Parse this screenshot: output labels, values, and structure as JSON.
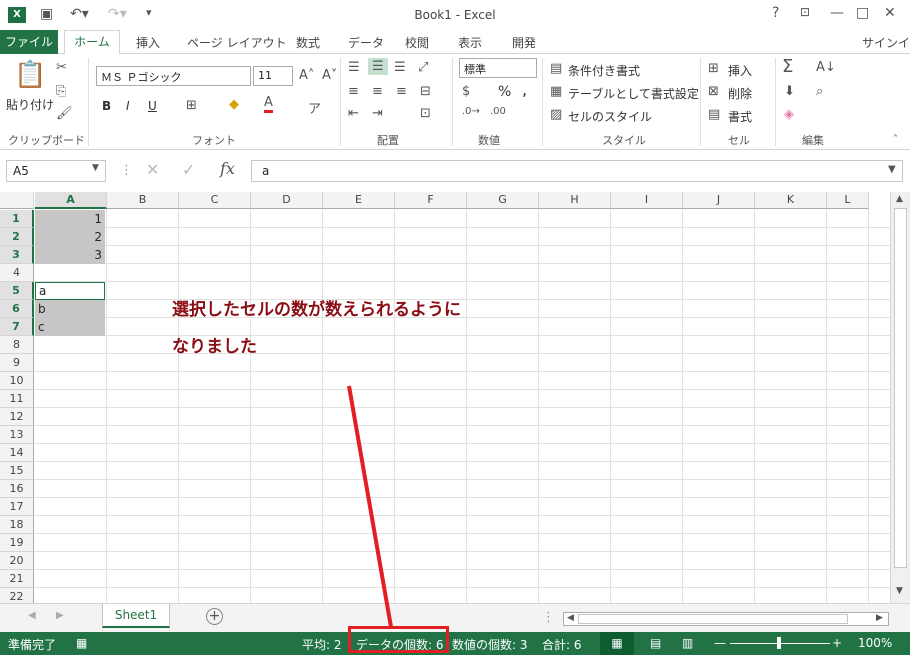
{
  "app": {
    "title": "Book1 - Excel",
    "logo": "X"
  },
  "window": {
    "help": "?",
    "restore": "⊡",
    "minimize": "—",
    "maximize": "□",
    "close": "✕"
  },
  "tabs": {
    "file": "ファイル",
    "home": "ホーム",
    "insert": "挿入",
    "page_layout": "ページ レイアウト",
    "formulas": "数式",
    "data": "データ",
    "review": "校閲",
    "view": "表示",
    "developer": "開発",
    "signin": "サインイン"
  },
  "ribbon": {
    "clipboard": {
      "paste": "貼り付け",
      "label": "クリップボード"
    },
    "font": {
      "name": "ＭＳ Ｐゴシック",
      "size": "11",
      "bold": "B",
      "italic": "I",
      "underline": "U",
      "label": "フォント"
    },
    "alignment": {
      "label": "配置"
    },
    "number": {
      "format": "標準",
      "percent": "%",
      "comma": ",",
      "label": "数値"
    },
    "styles": {
      "conditional": "条件付き書式",
      "as_table": "テーブルとして書式設定",
      "cell_styles": "セルのスタイル",
      "label": "スタイル"
    },
    "cells": {
      "insert": "挿入",
      "delete": "削除",
      "format": "書式",
      "label": "セル"
    },
    "editing": {
      "label": "編集"
    }
  },
  "formula_bar": {
    "name_box": "A5",
    "fx": "fx",
    "value": "a"
  },
  "columns": [
    "A",
    "B",
    "C",
    "D",
    "E",
    "F",
    "G",
    "H",
    "I",
    "J",
    "K",
    "L"
  ],
  "rows": [
    "1",
    "2",
    "3",
    "4",
    "5",
    "6",
    "7",
    "8",
    "9",
    "10",
    "11",
    "12",
    "13",
    "14",
    "15",
    "16",
    "17",
    "18",
    "19",
    "20",
    "21",
    "22"
  ],
  "cells": {
    "a1": "1",
    "a2": "2",
    "a3": "3",
    "a5": "a",
    "a6": "b",
    "a7": "c"
  },
  "annotation": {
    "line1": "選択したセルの数が数えられるように",
    "line2": "なりました"
  },
  "sheets": {
    "sheet1": "Sheet1",
    "add": "+"
  },
  "status": {
    "ready": "準備完了",
    "average": "平均: 2",
    "count": "データの個数: 6",
    "numeric_count": "数値の個数: 3",
    "sum": "合計: 6",
    "zoom": "100%"
  },
  "colors": {
    "accent": "#217346",
    "annotation": "#8b0d14",
    "highlight": "#e31e24"
  }
}
